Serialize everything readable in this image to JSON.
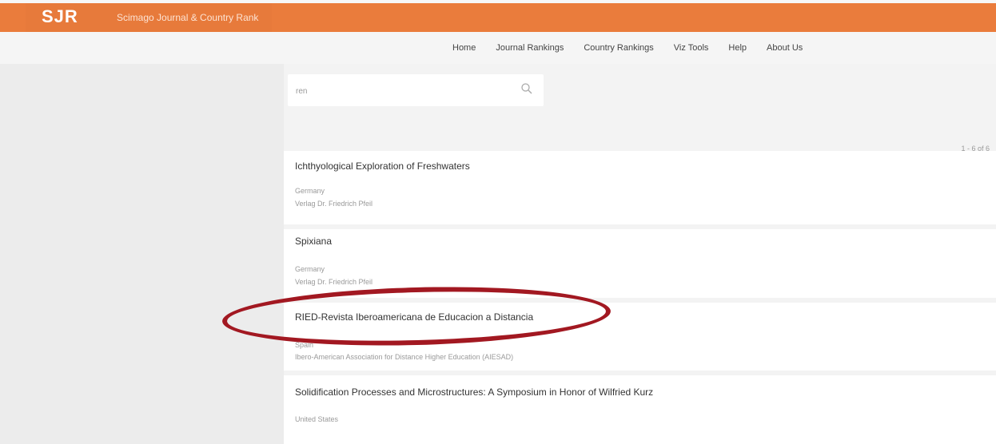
{
  "header": {
    "logo": "SJR",
    "brand": "Scimago Journal & Country Rank"
  },
  "nav": {
    "items": [
      "Home",
      "Journal Rankings",
      "Country Rankings",
      "Viz Tools",
      "Help",
      "About Us"
    ]
  },
  "search": {
    "value": "ren",
    "icon": "search-icon"
  },
  "results": {
    "count": "1 - 6 of 6",
    "items": [
      {
        "title": "Ichthyological Exploration of Freshwaters",
        "country": "Germany",
        "publisher": "Verlag Dr. Friedrich Pfeil"
      },
      {
        "title": "Spixiana",
        "country": "Germany",
        "publisher": "Verlag Dr. Friedrich Pfeil"
      },
      {
        "title": "RIED-Revista Iberoamericana de Educacion a Distancia",
        "country": "Spain",
        "publisher": "Ibero-American Association for Distance Higher Education (AIESAD)"
      },
      {
        "title": "Solidification Processes and Microstructures: A Symposium in Honor of Wilfried Kurz",
        "country": "United States",
        "publisher": ""
      }
    ]
  },
  "annotation": {
    "color": "#a21821"
  }
}
